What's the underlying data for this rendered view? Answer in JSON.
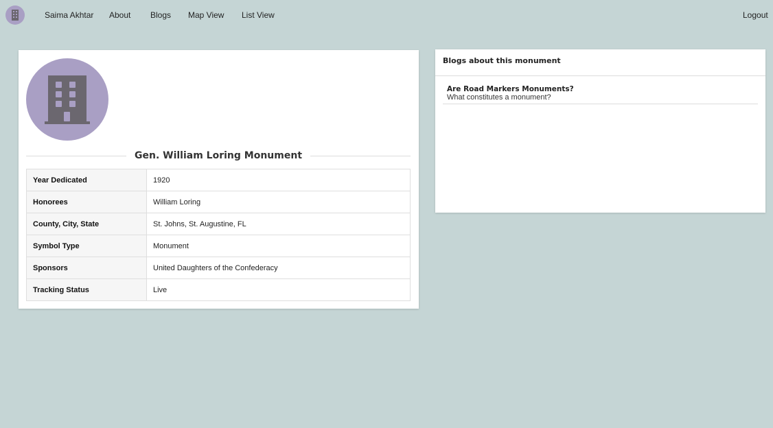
{
  "nav": {
    "logo_icon": "building-icon",
    "user_name": "Saima Akhtar",
    "about": "About",
    "blogs": "Blogs",
    "map_view": "Map View",
    "list_view": "List View",
    "logout": "Logout"
  },
  "colors": {
    "background": "#c5d5d5",
    "avatar": "#a99fc4",
    "icon": "#6b676f"
  },
  "monument": {
    "avatar_icon": "building-icon",
    "title": "Gen. William Loring Monument",
    "details": [
      {
        "label": "Year Dedicated",
        "value": "1920"
      },
      {
        "label": "Honorees",
        "value": "William Loring"
      },
      {
        "label": "County, City, State",
        "value": "St. Johns, St. Augustine, FL"
      },
      {
        "label": "Symbol Type",
        "value": "Monument"
      },
      {
        "label": "Sponsors",
        "value": "United Daughters of the Confederacy"
      },
      {
        "label": "Tracking Status",
        "value": "Live"
      }
    ]
  },
  "blogs": {
    "header": "Blogs about this monument",
    "items": [
      {
        "title": "Are Road Markers Monuments?",
        "subtitle": "What constitutes a monument?"
      }
    ]
  }
}
